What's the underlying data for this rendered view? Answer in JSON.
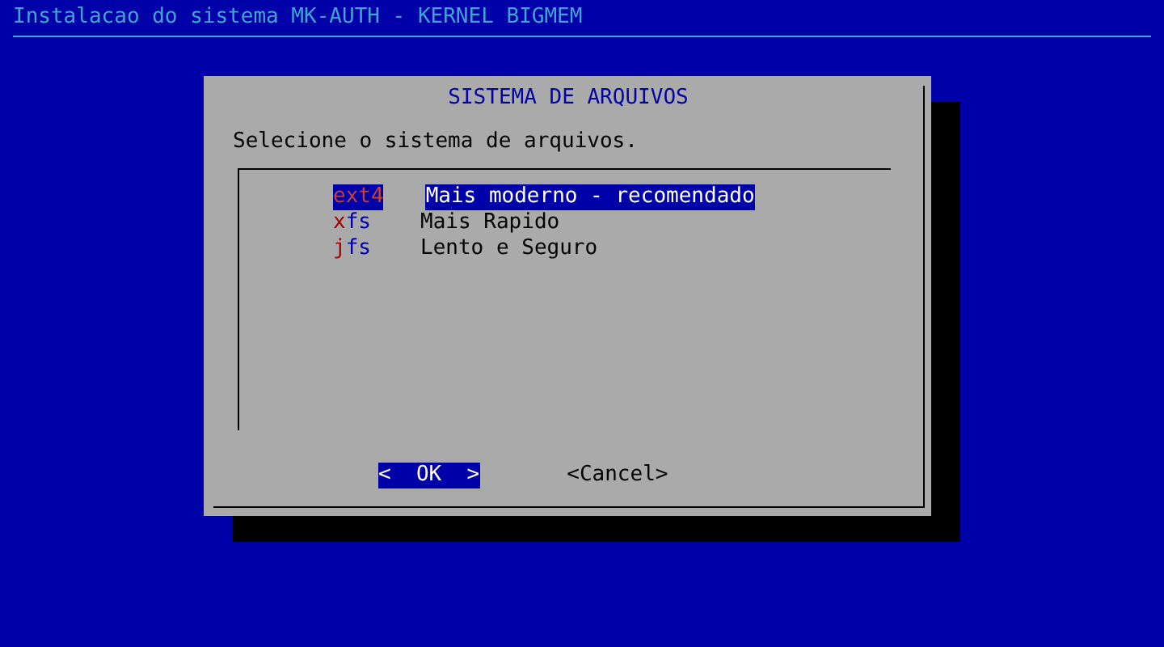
{
  "screen": {
    "title": "Instalacao do sistema MK-AUTH - KERNEL BIGMEM"
  },
  "dialog": {
    "title": "SISTEMA DE ARQUIVOS",
    "prompt": "Selecione o sistema de arquivos.",
    "items": [
      {
        "tag": "ext4",
        "description": "Mais moderno - recomendado",
        "selected": true
      },
      {
        "tag": "xfs",
        "description": "Mais Rapido",
        "selected": false
      },
      {
        "tag": "jfs",
        "description": "Lento e Seguro",
        "selected": false
      }
    ],
    "buttons": [
      {
        "label": "<  OK  >",
        "selected": true
      },
      {
        "label": "<Cancel>",
        "selected": false
      }
    ]
  }
}
